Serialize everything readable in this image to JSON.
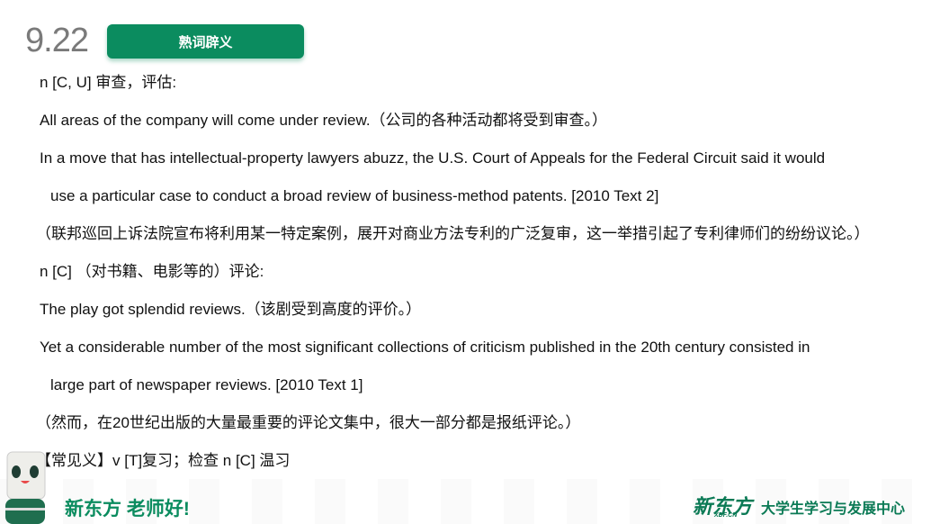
{
  "header": {
    "date": "9.22",
    "badge": "熟词辟义"
  },
  "lines": [
    "n [C, U] 审查，评估:",
    "All areas of the company will come under review.（公司的各种活动都将受到审查。）",
    "In a move that has intellectual-property lawyers abuzz, the U.S. Court of Appeals for the Federal Circuit said it would",
    "use a particular case to conduct a broad review of business-method patents. [2010 Text 2]",
    "（联邦巡回上诉法院宣布将利用某一特定案例，展开对商业方法专利的广泛复审，这一举措引起了专利律师们的纷纷议论。）",
    "n [C] （对书籍、电影等的）评论:",
    "The play got splendid reviews.（该剧受到高度的评价。）",
    "Yet a considerable number of the most significant collections of criticism published in the 20th century consisted in",
    "large part of newspaper reviews. [2010 Text 1]",
    "（然而，在20世纪出版的大量最重要的评论文集中，很大一部分都是报纸评论。）",
    "【常见义】v [T]复习；检查 n [C] 温习"
  ],
  "footer": {
    "slogan": "新东方 老师好!",
    "logo": "新东方",
    "logo_sub": "XDF.CN",
    "center": "大学生学习与发展中心"
  },
  "colors": {
    "brand": "#0b8c5f",
    "date": "#7a7a7a"
  }
}
